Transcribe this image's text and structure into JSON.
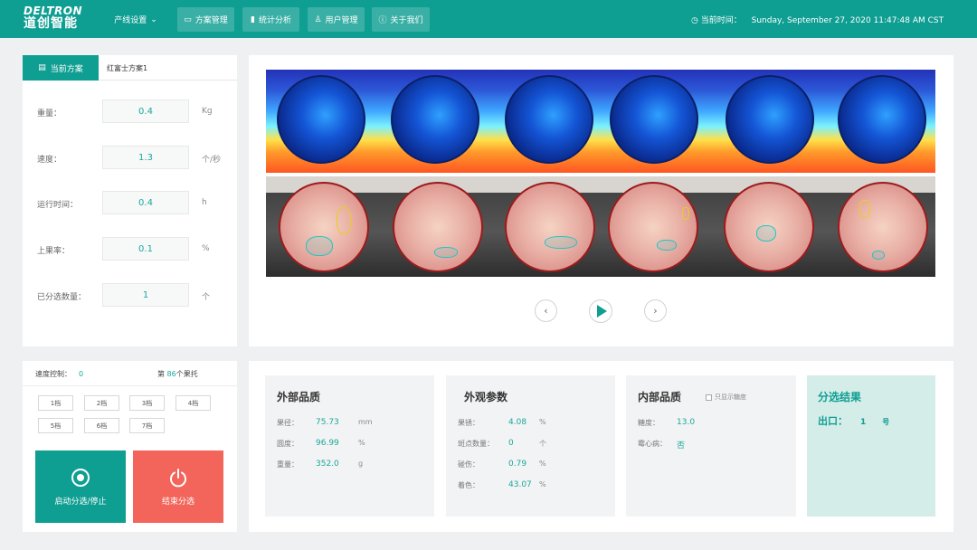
{
  "header": {
    "logo_en": "DELTRON",
    "logo_cn": "道创智能",
    "nav": [
      {
        "label": "产线设置",
        "icon": "chevron-down"
      },
      {
        "label": "方案管理",
        "icon": "folder"
      },
      {
        "label": "统计分析",
        "icon": "bar-chart"
      },
      {
        "label": "用户管理",
        "icon": "user"
      },
      {
        "label": "关于我们",
        "icon": "info"
      }
    ],
    "time_label": "当前时间：",
    "time_value": "Sunday, September 27, 2020 11:47:48 AM CST"
  },
  "scheme": {
    "tab_label": "当前方案",
    "name": "红富士方案1"
  },
  "params": [
    {
      "label": "重量：",
      "value": "0.4",
      "unit": "Kg"
    },
    {
      "label": "速度：",
      "value": "1.3",
      "unit": "个/秒"
    },
    {
      "label": "运行时间：",
      "value": "0.4",
      "unit": "h"
    },
    {
      "label": "上果率：",
      "value": "0.1",
      "unit": "%"
    },
    {
      "label": "已分选数量：",
      "value": "1",
      "unit": "个"
    }
  ],
  "control": {
    "speed_label": "速度控制：",
    "speed_value": "0",
    "tray_prefix": "第",
    "tray_value": "86",
    "tray_suffix": "个果托",
    "gears": [
      "1档",
      "2档",
      "3档",
      "4档",
      "5档",
      "6档",
      "7档"
    ],
    "start_label": "启动分选/停止",
    "stop_label": "结束分选"
  },
  "quality": {
    "external": {
      "title": "外部品质",
      "rows": [
        {
          "label": "果径：",
          "value": "75.73",
          "unit": "mm"
        },
        {
          "label": "圆度：",
          "value": "96.99",
          "unit": "%"
        },
        {
          "label": "重量：",
          "value": "352.0",
          "unit": "g"
        }
      ]
    },
    "appearance": {
      "title": "外观参数",
      "rows": [
        {
          "label": "果锈：",
          "value": "4.08",
          "unit": "%"
        },
        {
          "label": "斑点数量：",
          "value": "0",
          "unit": "个"
        },
        {
          "label": "碰伤：",
          "value": "0.79",
          "unit": "%"
        },
        {
          "label": "着色：",
          "value": "43.07",
          "unit": "%"
        }
      ]
    },
    "internal": {
      "title": "内部品质",
      "checkbox_label": "只显示糖度",
      "rows": [
        {
          "label": "糖度：",
          "value": "13.0",
          "unit": ""
        },
        {
          "label": "霉心病：",
          "value": "否",
          "unit": ""
        }
      ]
    },
    "result": {
      "title": "分选结果",
      "outlet_label": "出口：",
      "outlet_value": "1",
      "outlet_unit": "号"
    }
  },
  "colors": {
    "primary": "#0f9e92",
    "danger": "#f3655a",
    "value": "#1aa89c"
  }
}
